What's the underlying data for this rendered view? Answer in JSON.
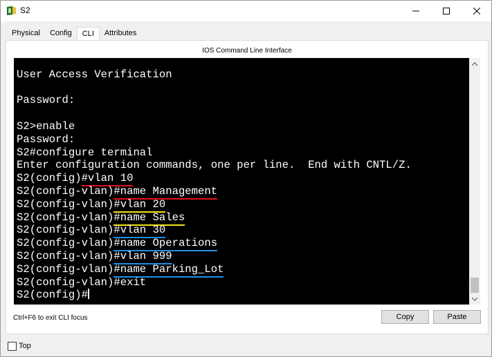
{
  "window": {
    "title": "S2",
    "controls": {
      "minimize": "–",
      "maximize": "☐",
      "close": "✕"
    }
  },
  "tabs": [
    {
      "label": "Physical",
      "active": false
    },
    {
      "label": "Config",
      "active": false
    },
    {
      "label": "CLI",
      "active": true
    },
    {
      "label": "Attributes",
      "active": false
    }
  ],
  "panel": {
    "title": "IOS Command Line Interface"
  },
  "terminal": {
    "lines": [
      {
        "prompt": "",
        "command": "",
        "text": ""
      },
      {
        "prompt": "",
        "command": "",
        "text": "User Access Verification"
      },
      {
        "prompt": "",
        "command": "",
        "text": ""
      },
      {
        "prompt": "",
        "command": "",
        "text": "Password:"
      },
      {
        "prompt": "",
        "command": "",
        "text": ""
      },
      {
        "prompt": "",
        "command": "",
        "text": "S2>enable"
      },
      {
        "prompt": "",
        "command": "",
        "text": "Password:"
      },
      {
        "prompt": "",
        "command": "",
        "text": "S2#configure terminal"
      },
      {
        "prompt": "",
        "command": "",
        "text": "Enter configuration commands, one per line.  End with CNTL/Z."
      },
      {
        "prompt": "S2(config)",
        "command": "#vlan 10",
        "text": "",
        "underline": "#e5101c"
      },
      {
        "prompt": "S2(config-vlan)",
        "command": "#name Management",
        "text": "",
        "underline": "#e5101c"
      },
      {
        "prompt": "S2(config-vlan)",
        "command": "#vlan 20",
        "text": "",
        "underline": "#f2e61a"
      },
      {
        "prompt": "S2(config-vlan)",
        "command": "#name Sales",
        "text": "",
        "underline": "#f2e61a"
      },
      {
        "prompt": "S2(config-vlan)",
        "command": "#vlan 30",
        "text": "",
        "underline": "#1e90e8"
      },
      {
        "prompt": "S2(config-vlan)",
        "command": "#name Operations",
        "text": "",
        "underline": "#1e90e8"
      },
      {
        "prompt": "S2(config-vlan)",
        "command": "#vlan 999",
        "text": "",
        "underline": "#1e90e8"
      },
      {
        "prompt": "S2(config-vlan)",
        "command": "#name Parking_Lot",
        "text": "",
        "underline": "#1e90e8"
      },
      {
        "prompt": "",
        "command": "",
        "text": "S2(config-vlan)#exit"
      },
      {
        "prompt": "",
        "command": "",
        "text": "S2(config)#",
        "cursor": true
      }
    ]
  },
  "footer": {
    "hint": "Ctrl+F6 to exit CLI focus",
    "copy_label": "Copy",
    "paste_label": "Paste"
  },
  "bottom": {
    "top_label": "Top",
    "top_checked": false
  },
  "colors": {
    "terminal_bg": "#000000",
    "terminal_fg": "#ffffff",
    "active_tab_underline": "#0a2a6b"
  }
}
